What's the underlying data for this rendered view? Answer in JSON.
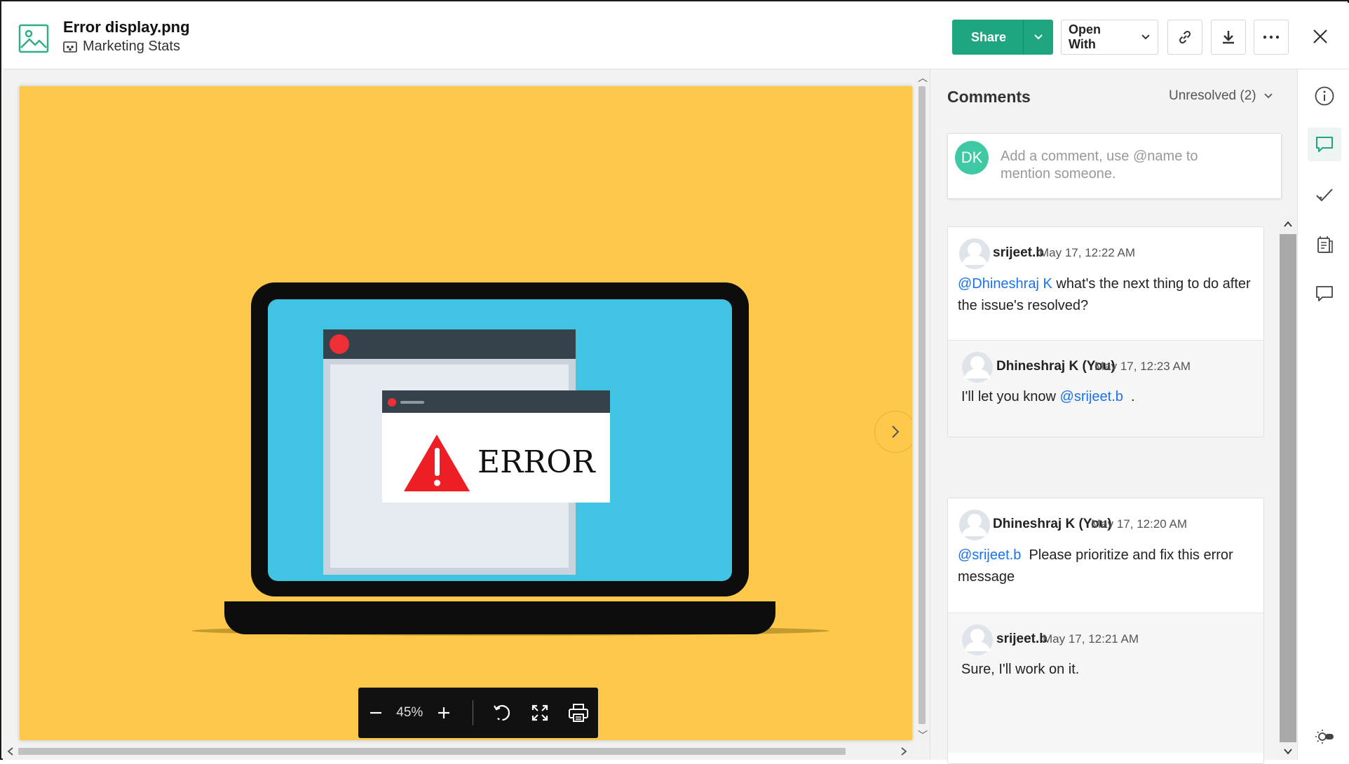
{
  "file": {
    "title": "Error display.png",
    "folder": "Marketing Stats"
  },
  "toolbar": {
    "share_label": "Share",
    "open_with_label": "Open With"
  },
  "image": {
    "error_text": "ERROR"
  },
  "viewer_controls": {
    "zoom": "45%"
  },
  "comments": {
    "title": "Comments",
    "filter_label": "Unresolved (2)",
    "current_user_initials": "DK",
    "input_placeholder": "Add a comment, use @name to mention someone.",
    "threads": [
      {
        "main": {
          "author": "srijeet.b",
          "time": "May 17, 12:22 AM",
          "mention": "@Dhineshraj K",
          "text": " what's the next thing to do after the issue's resolved?"
        },
        "reply": {
          "author": "Dhineshraj K (You)",
          "time": "May 17, 12:23 AM",
          "text_before": "I'll let you know ",
          "mention": "@srijeet.b",
          "text_after": "  ."
        }
      },
      {
        "main": {
          "author": "Dhineshraj K (You)",
          "time": "May 17, 12:20 AM",
          "mention": "@srijeet.b",
          "text": "  Please prioritize and fix this error message"
        },
        "reply": {
          "author": "srijeet.b",
          "time": "May 17, 12:21 AM",
          "text": "Sure, I'll work on it."
        }
      }
    ]
  },
  "colors": {
    "share_green": "#1fa57f",
    "image_background": "#fec84a",
    "mention_blue": "#1a73e8",
    "avatar_green": "#3ec8a3"
  }
}
